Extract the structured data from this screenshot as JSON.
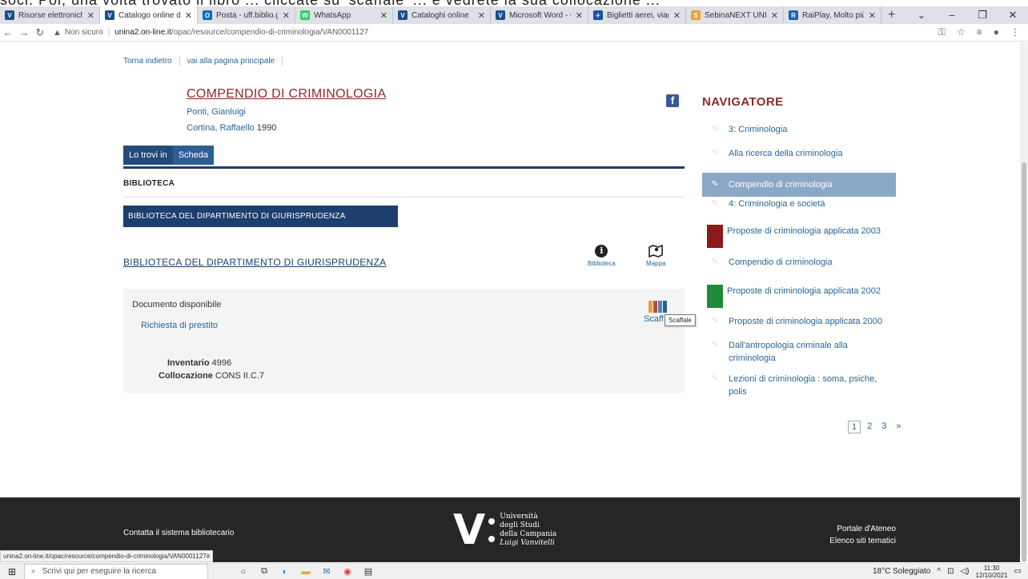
{
  "banner_text": "soci. Poi, una volta trovato il libro ... cliccate su 'scaffale' ... e vedrete la sua collocazione ...",
  "browser": {
    "tabs": [
      {
        "icon_color": "#1a4e8c",
        "icon_text": "V",
        "label": "Risorse elettroniche",
        "active": false
      },
      {
        "icon_color": "#1a4e8c",
        "icon_text": "V",
        "label": "Catalogo online dell'U",
        "active": true
      },
      {
        "icon_color": "#0f6cbd",
        "icon_text": "O",
        "label": "Posta - uff.biblio.giuris",
        "active": false
      },
      {
        "icon_color": "#25d366",
        "icon_text": "W",
        "label": "WhatsApp",
        "active": false
      },
      {
        "icon_color": "#1a4e8c",
        "icon_text": "V",
        "label": "Cataloghi online",
        "active": false
      },
      {
        "icon_color": "#1a4e8c",
        "icon_text": "V",
        "label": "Microsoft Word - Guid",
        "active": false
      },
      {
        "icon_color": "#1e4fa0",
        "icon_text": "✈",
        "label": "Biglietti aerei, viaggi",
        "active": false
      },
      {
        "icon_color": "#f0a030",
        "icon_text": "S",
        "label": "SebinaNEXT UNICAMI",
        "active": false
      },
      {
        "icon_color": "#1f5fb8",
        "icon_text": "R",
        "label": "RaiPlay, Molto più",
        "active": false
      }
    ],
    "new_tab": "+",
    "security_label": "Non sicuro",
    "url_host": "unina2.on-line.it",
    "url_path": "/opac/resource/compendio-di-criminologia/VAN0001127",
    "status_url": "unina2.on-line.it/opac/resource/compendio-di-criminologia/VAN0001127#"
  },
  "breadcrumbs": {
    "back": "Torna indietro",
    "home": "vai alla pagina principale"
  },
  "record": {
    "title": "COMPENDIO DI CRIMINOLOGIA",
    "author": "Ponti, Gianluigi",
    "publisher": "Cortina, Raffaello",
    "year": "1990"
  },
  "tabs": {
    "found_in": "Lo trovi in",
    "sheet": "Scheda"
  },
  "library_section": {
    "heading": "BIBLIOTECA",
    "library_box": "BIBLIOTECA DEL DIPARTIMENTO DI GIURISPRUDENZA",
    "library_link": "BIBLIOTECA DEL DIPARTIMENTO DI GIURISPRUDENZA",
    "info_label": "Biblioteca",
    "map_label": "Mappa"
  },
  "holding": {
    "availability": "Documento disponibile",
    "loan_request": "Richiesta di prestito",
    "shelf_label": "Scaffale",
    "shelf_visible": "Scaff",
    "tooltip": "Scaffale",
    "inventory_label": "Inventario",
    "inventory_value": "4996",
    "location_label": "Collocazione",
    "location_value": "CONS II.C.7",
    "shelf_colors": [
      "#e8a33c",
      "#c7463c",
      "#3d8cc0",
      "#2f5f8f"
    ]
  },
  "navigator": {
    "title": "NAVIGATORE",
    "items": [
      {
        "label": "3: Criminologia",
        "kind": "icon",
        "selected": false
      },
      {
        "label": "Alla ricerca della criminologia",
        "kind": "icon",
        "selected": false
      },
      {
        "label": "Compendio di criminologia",
        "kind": "icon",
        "selected": true
      },
      {
        "label": "4: Criminologia e società",
        "kind": "icon",
        "selected": false
      },
      {
        "label": "Proposte di criminologia applicata 2003",
        "kind": "cover",
        "cover_color": "#8b1a1a",
        "selected": false
      },
      {
        "label": "Compendio di criminologia",
        "kind": "icon",
        "selected": false
      },
      {
        "label": "Proposte di criminologia applicata 2002",
        "kind": "cover",
        "cover_color": "#1f8a3a",
        "selected": false
      },
      {
        "label": "Proposte di criminologia applicata 2000",
        "kind": "icon",
        "selected": false
      },
      {
        "label": "Dall'antropologia criminale alla criminologia",
        "kind": "icon",
        "selected": false
      },
      {
        "label": "Lezioni di criminologia : soma, psiche, polis",
        "kind": "icon",
        "selected": false
      }
    ],
    "pages": [
      "1",
      "2",
      "3",
      "»"
    ]
  },
  "footer": {
    "contact": "Contatta il sistema bibliotecario",
    "uni_line1": "Università",
    "uni_line2": "degli Studi",
    "uni_line3": "della Campania",
    "uni_line4": "Luigi Vanvitelli",
    "portal": "Portale d'Ateneo",
    "sites": "Elenco siti tematici"
  },
  "taskbar": {
    "search_placeholder": "Scrivi qui per eseguire la ricerca",
    "weather": "18°C Soleggiato",
    "time": "11:30",
    "date": "12/10/2021"
  }
}
